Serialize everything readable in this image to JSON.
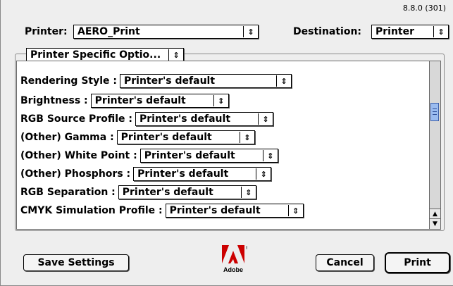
{
  "version": "8.8.0 (301)",
  "header": {
    "printer_label": "Printer:",
    "printer_value": "AERO_Print",
    "destination_label": "Destination:",
    "destination_value": "Printer"
  },
  "section_popup": "Printer Specific Optio...",
  "options": [
    {
      "label": "Rendering Style :",
      "value": "Printer's default"
    },
    {
      "label": "Brightness :",
      "value": "Printer's default"
    },
    {
      "label": "RGB Source Profile :",
      "value": "Printer's default"
    },
    {
      "label": "(Other) Gamma :",
      "value": "Printer's default"
    },
    {
      "label": "(Other) White Point :",
      "value": "Printer's default"
    },
    {
      "label": "(Other) Phosphors :",
      "value": "Printer's default"
    },
    {
      "label": "RGB Separation :",
      "value": "Printer's default"
    },
    {
      "label": "CMYK Simulation Profile :",
      "value": "Printer's default"
    }
  ],
  "buttons": {
    "save": "Save Settings",
    "cancel": "Cancel",
    "print": "Print"
  },
  "logo": {
    "text": "Adobe",
    "color": "#cc0000",
    "icon": "adobe-logo-icon"
  },
  "colors": {
    "scroll_thumb": "#9bbcf0"
  }
}
